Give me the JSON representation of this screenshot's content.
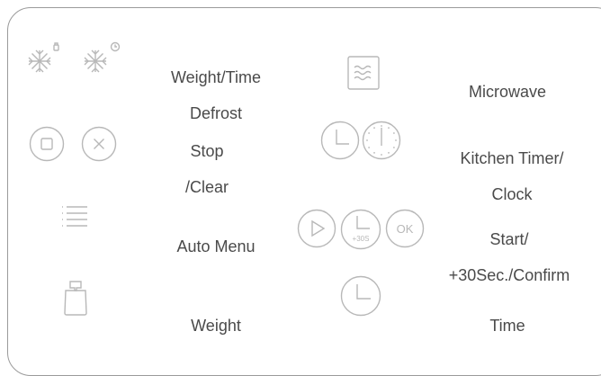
{
  "panel": {
    "controls": [
      {
        "id": "weight-time-defrost",
        "lines": [
          "Weight/Time",
          "Defrost"
        ]
      },
      {
        "id": "microwave",
        "lines": [
          "Microwave"
        ]
      },
      {
        "id": "stop-clear",
        "lines": [
          "Stop",
          "/Clear"
        ]
      },
      {
        "id": "kitchen-timer-clock",
        "lines": [
          "Kitchen Timer/",
          "Clock"
        ]
      },
      {
        "id": "auto-menu",
        "lines": [
          "Auto Menu"
        ]
      },
      {
        "id": "start-confirm",
        "lines": [
          "Start/",
          "+30Sec./Confirm"
        ]
      },
      {
        "id": "weight",
        "lines": [
          "Weight"
        ]
      },
      {
        "id": "time",
        "lines": [
          "Time"
        ]
      }
    ],
    "icons": {
      "plus30_text": "+30S",
      "ok_text": "OK"
    },
    "colors": {
      "icon_stroke": "#b8b8b8",
      "label_text": "#4a4a4a",
      "border": "#9a9a9a"
    }
  }
}
